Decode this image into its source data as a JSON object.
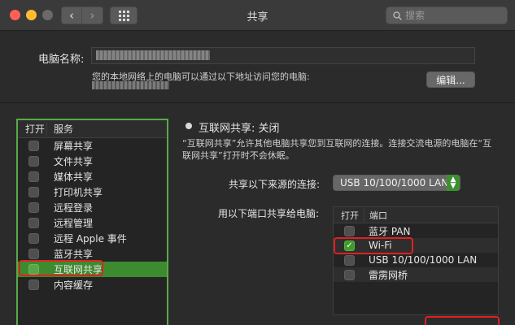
{
  "window": {
    "title": "共享",
    "search_placeholder": "搜索"
  },
  "computer": {
    "name_label": "电脑名称:",
    "access_note": "您的本地网络上的电脑可以通过以下地址访问您的电脑:",
    "edit_label": "编辑..."
  },
  "services": {
    "header_open": "打开",
    "header_service": "服务",
    "items": [
      {
        "label": "屏幕共享",
        "checked": false
      },
      {
        "label": "文件共享",
        "checked": false
      },
      {
        "label": "媒体共享",
        "checked": false
      },
      {
        "label": "打印机共享",
        "checked": false
      },
      {
        "label": "远程登录",
        "checked": false
      },
      {
        "label": "远程管理",
        "checked": false
      },
      {
        "label": "远程 Apple 事件",
        "checked": false
      },
      {
        "label": "蓝牙共享",
        "checked": false
      },
      {
        "label": "互联网共享",
        "checked": false,
        "selected": true
      },
      {
        "label": "内容缓存",
        "checked": false
      }
    ]
  },
  "detail": {
    "status": "互联网共享: 关闭",
    "description": "“互联网共享”允许其他电脑共享您到互联网的连接。连接交流电源的电脑在“互联网共享”打开时不会休眠。",
    "share_from_label": "共享以下来源的连接:",
    "share_from_value": "USB 10/100/1000 LAN",
    "ports_label": "用以下端口共享给电脑:",
    "ports_header_open": "打开",
    "ports_header_port": "端口",
    "ports": [
      {
        "label": "蓝牙 PAN",
        "checked": false
      },
      {
        "label": "Wi-Fi",
        "checked": true
      },
      {
        "label": "USB 10/100/1000 LAN",
        "checked": false
      },
      {
        "label": "雷雳网桥",
        "checked": false
      }
    ]
  },
  "colors": {
    "accent_green": "#3d8b2f",
    "highlight_red": "#e02020"
  }
}
